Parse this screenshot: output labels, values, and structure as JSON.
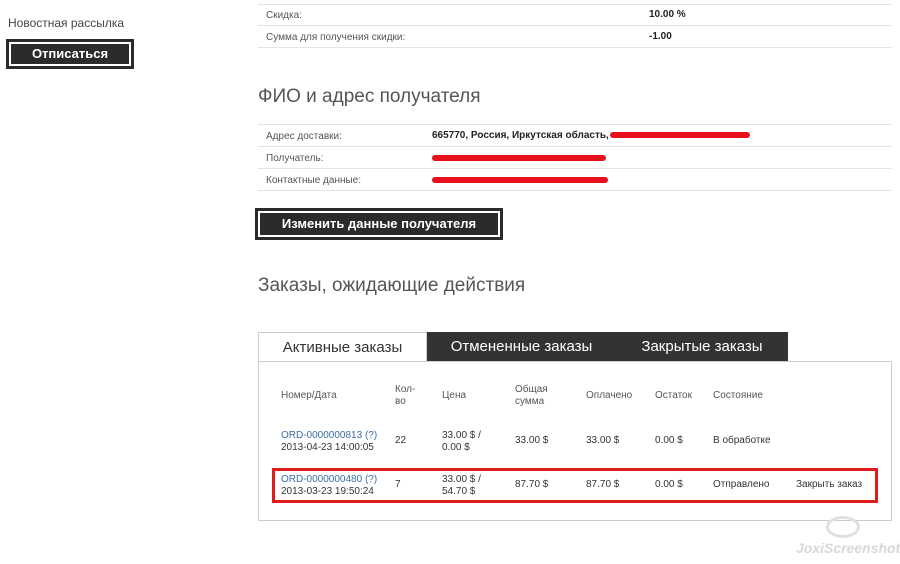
{
  "sidebar": {
    "newsletter_title": "Новостная рассылка",
    "unsubscribe_label": "Отписаться"
  },
  "discount": {
    "rows": [
      {
        "label": "Скидка:",
        "value": "10.00 %"
      },
      {
        "label": "Сумма для получения скидки:",
        "value": "-1.00"
      }
    ]
  },
  "recipient": {
    "title": "ФИО и адрес получателя",
    "rows": [
      {
        "label": "Адрес доставки:",
        "value": "665770, Россия, Иркутская область,"
      },
      {
        "label": "Получатель:",
        "value": ""
      },
      {
        "label": "Контактные данные:",
        "value": ""
      }
    ],
    "change_button": "Изменить данные получателя"
  },
  "orders": {
    "title": "Заказы, ожидающие действия",
    "tabs": [
      {
        "label": "Активные заказы",
        "active": true
      },
      {
        "label": "Отмененные заказы",
        "active": false
      },
      {
        "label": "Закрытые заказы",
        "active": false
      }
    ],
    "columns": {
      "number": "Номер/Дата",
      "qty_1": "Кол-",
      "qty_2": "во",
      "price": "Цена",
      "total_1": "Общая",
      "total_2": "сумма",
      "paid": "Оплачено",
      "rest": "Остаток",
      "status": "Состояние"
    },
    "rows": [
      {
        "number": "ORD-0000000813 (?)",
        "date": "2013-04-23 14:00:05",
        "qty": "22",
        "price_1": "33.00 $ /",
        "price_2": "0.00 $",
        "total": "33.00 $",
        "paid": "33.00 $",
        "rest": "0.00 $",
        "status": "В обработке",
        "action": ""
      },
      {
        "number": "ORD-0000000480 (?)",
        "date": "2013-03-23 19:50:24",
        "qty": "7",
        "price_1": "33.00 $ /",
        "price_2": "54.70 $",
        "total": "87.70 $",
        "paid": "87.70 $",
        "rest": "0.00 $",
        "status": "Отправлено",
        "action": "Закрыть заказ"
      }
    ]
  },
  "watermark": "JoxiScreenshot",
  "colors": {
    "highlight": "#e01b1b",
    "redaction": "#e8101a",
    "dark": "#2b2b2b",
    "link": "#3a6ea5"
  }
}
